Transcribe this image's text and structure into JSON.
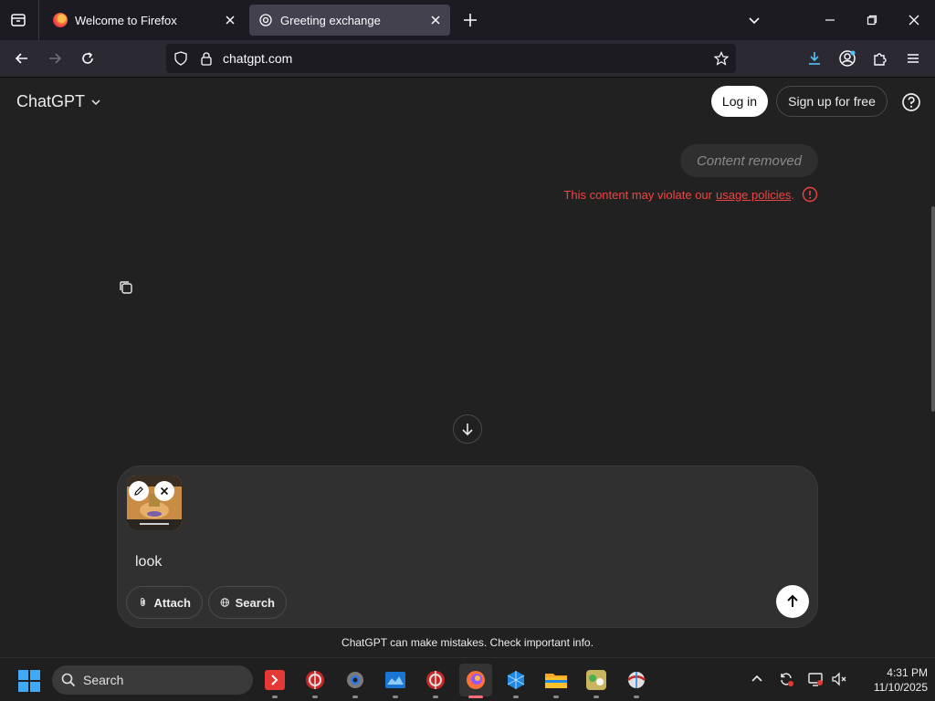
{
  "browser": {
    "tabs": [
      {
        "title": "Welcome to Firefox",
        "active": false
      },
      {
        "title": "Greeting exchange",
        "active": true
      }
    ],
    "url": "chatgpt.com"
  },
  "header": {
    "brand": "ChatGPT",
    "login_label": "Log in",
    "signup_label": "Sign up for free"
  },
  "chat": {
    "removed_text": "Content removed",
    "violation_prefix": "This content may violate our",
    "violation_link": "usage policies",
    "violation_suffix": "."
  },
  "composer": {
    "prompt_value": "look",
    "attach_label": "Attach",
    "search_label": "Search"
  },
  "footer": {
    "disclaimer": "ChatGPT can make mistakes. Check important info."
  },
  "taskbar": {
    "search_label": "Search",
    "time": "4:31 PM",
    "date": "11/10/2025",
    "apps": [
      "app-red-icon",
      "app-globe-icon",
      "settings-icon",
      "app-blue-icon",
      "app-globe-icon",
      "firefox-icon",
      "app-cube-icon",
      "file-explorer-icon",
      "app-game-icon",
      "app-globe-icon"
    ]
  },
  "colors": {
    "page_bg": "#212121",
    "composer_bg": "#303030",
    "violation": "#ef4444",
    "tab_active": "#42414d"
  }
}
